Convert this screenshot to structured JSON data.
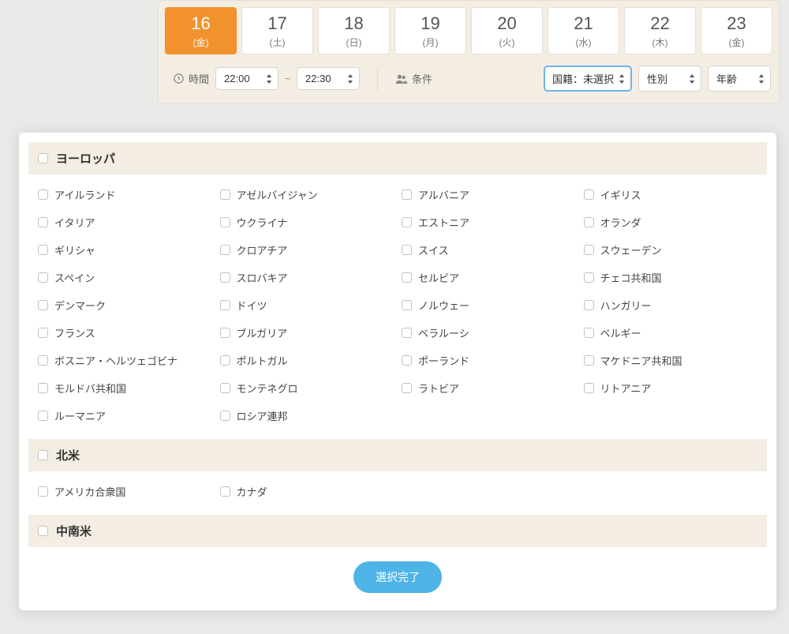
{
  "dates": [
    {
      "num": "16",
      "day": "(金)",
      "active": true
    },
    {
      "num": "17",
      "day": "(土)"
    },
    {
      "num": "18",
      "day": "(日)"
    },
    {
      "num": "19",
      "day": "(月)"
    },
    {
      "num": "20",
      "day": "(火)"
    },
    {
      "num": "21",
      "day": "(水)"
    },
    {
      "num": "22",
      "day": "(木)"
    },
    {
      "num": "23",
      "day": "(金)"
    }
  ],
  "filters": {
    "time_label": "時間",
    "time_from": "22:00",
    "time_to": "22:30",
    "conditions_label": "条件",
    "nationality": "国籍：未選択",
    "gender": "性別",
    "age": "年齢"
  },
  "regions": [
    {
      "name": "ヨーロッパ",
      "countries": [
        "アイルランド",
        "アゼルバイジャン",
        "アルバニア",
        "イギリス",
        "イタリア",
        "ウクライナ",
        "エストニア",
        "オランダ",
        "ギリシャ",
        "クロアチア",
        "スイス",
        "スウェーデン",
        "スペイン",
        "スロバキア",
        "セルビア",
        "チェコ共和国",
        "デンマーク",
        "ドイツ",
        "ノルウェー",
        "ハンガリー",
        "フランス",
        "ブルガリア",
        "ベラルーシ",
        "ベルギー",
        "ボスニア・ヘルツェゴビナ",
        "ポルトガル",
        "ポーランド",
        "マケドニア共和国",
        "モルドバ共和国",
        "モンテネグロ",
        "ラトビア",
        "リトアニア",
        "ルーマニア",
        "ロシア連邦"
      ]
    },
    {
      "name": "北米",
      "countries": [
        "アメリカ合衆国",
        "カナダ"
      ]
    },
    {
      "name": "中南米",
      "countries": []
    }
  ],
  "done_button": "選択完了"
}
